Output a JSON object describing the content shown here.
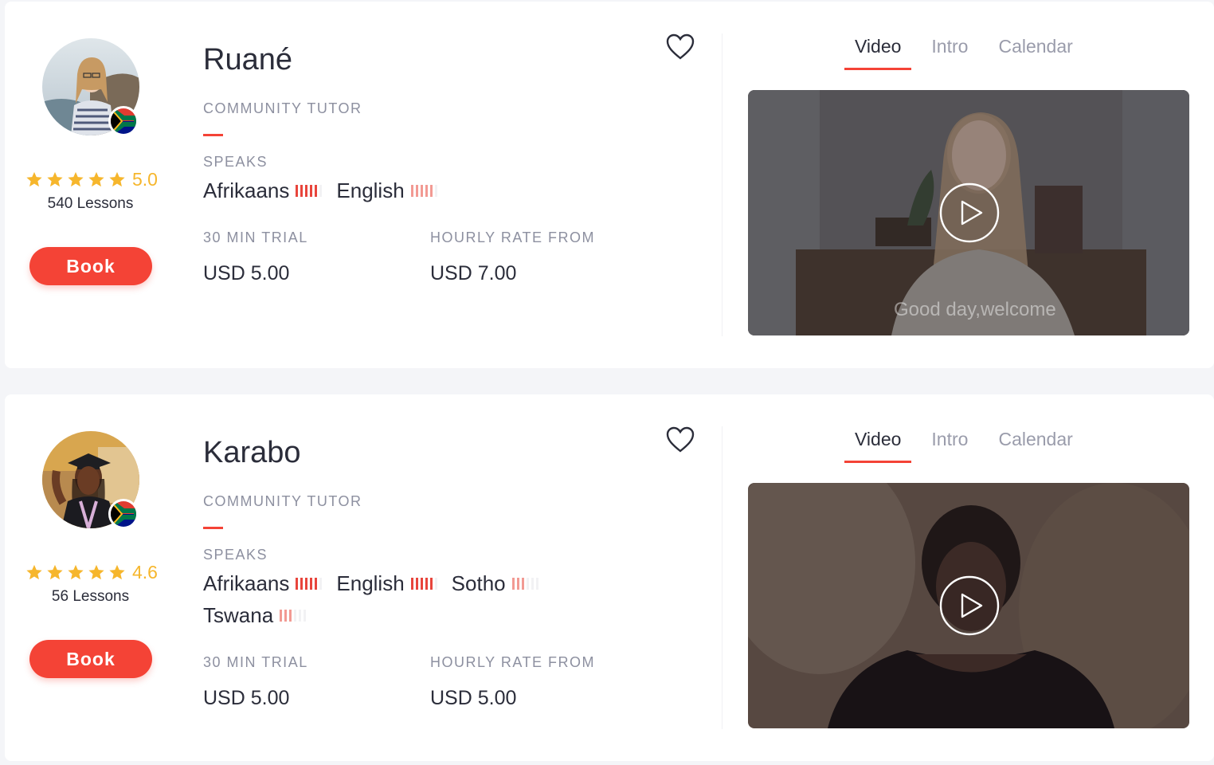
{
  "tutors": [
    {
      "name": "Ruané",
      "role": "COMMUNITY TUTOR",
      "rating": "5.0",
      "stars": 5,
      "lessons": "540 Lessons",
      "book_label": "Book",
      "speaks_label": "SPEAKS",
      "languages": [
        {
          "name": "Afrikaans",
          "level": 5,
          "color": "#e8453c"
        },
        {
          "name": "English",
          "level": 5,
          "color": "#f29a93"
        }
      ],
      "trial_label": "30 MIN TRIAL",
      "trial_price": "USD 5.00",
      "rate_label": "HOURLY RATE FROM",
      "rate_price": "USD 7.00",
      "tabs": [
        "Video",
        "Intro",
        "Calendar"
      ],
      "active_tab": "Video",
      "video_caption": "Good day,welcome"
    },
    {
      "name": "Karabo",
      "role": "COMMUNITY TUTOR",
      "rating": "4.6",
      "stars": 5,
      "lessons": "56 Lessons",
      "book_label": "Book",
      "speaks_label": "SPEAKS",
      "languages": [
        {
          "name": "Afrikaans",
          "level": 5,
          "color": "#e8453c"
        },
        {
          "name": "English",
          "level": 5,
          "color": "#e8453c"
        },
        {
          "name": "Sotho",
          "level": 3,
          "color": "#f29a93"
        },
        {
          "name": "Tswana",
          "level": 3,
          "color": "#f29a93"
        }
      ],
      "trial_label": "30 MIN TRIAL",
      "trial_price": "USD 5.00",
      "rate_label": "HOURLY RATE FROM",
      "rate_price": "USD 5.00",
      "tabs": [
        "Video",
        "Intro",
        "Calendar"
      ],
      "active_tab": "Video",
      "video_caption": ""
    }
  ],
  "colors": {
    "accent": "#f44336",
    "star": "#f6b62c",
    "muted": "#8d90a0"
  }
}
